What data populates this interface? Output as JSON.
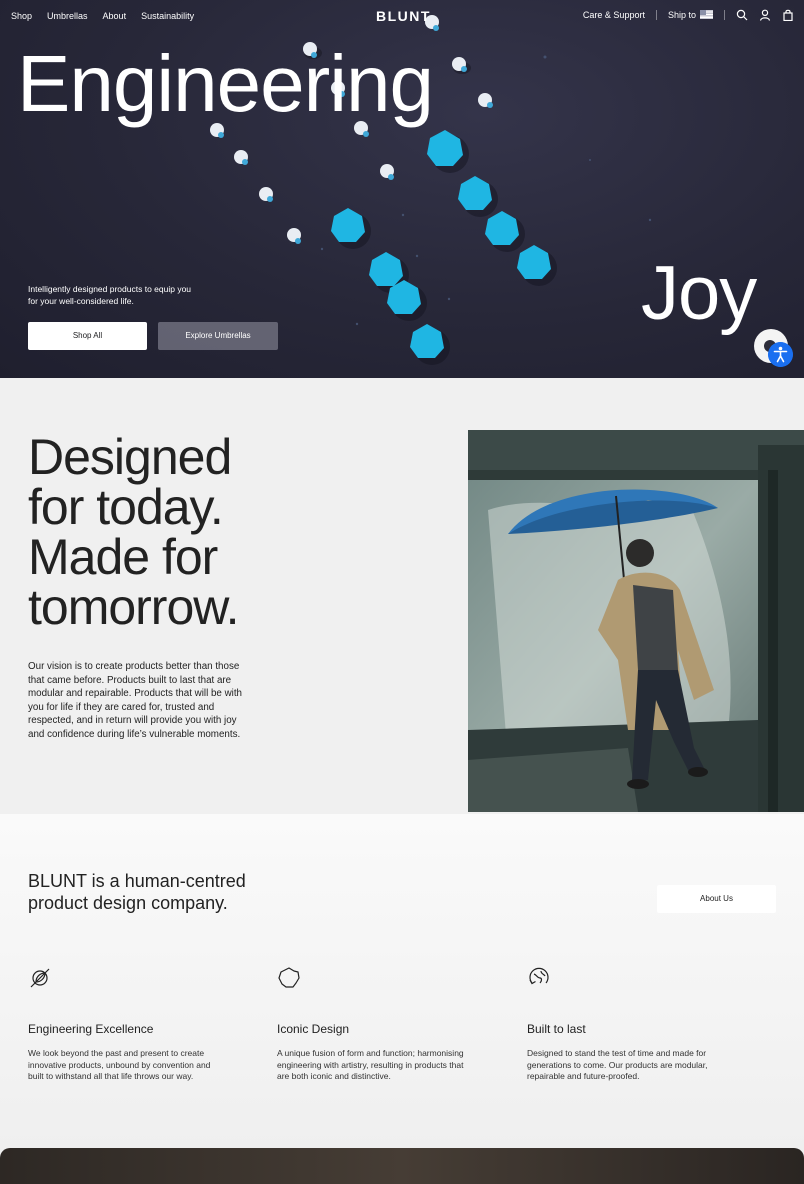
{
  "nav": {
    "links": [
      "Shop",
      "Umbrellas",
      "About",
      "Sustainability"
    ],
    "logo": "BLUNT",
    "care": "Care & Support",
    "ship": "Ship to"
  },
  "hero": {
    "title": "Engineering",
    "word": "Joy",
    "subtitle": "Intelligently designed products to equip you for your well-considered life.",
    "shop_button": "Shop All",
    "explore_button": "Explore Umbrellas"
  },
  "designed": {
    "heading_lines": [
      "Designed",
      "for today.",
      "Made for",
      "tomorrow."
    ],
    "body": "Our vision is to create products better than those that came before. Products built to last that are modular and repairable. Products that will be with you for life if they are cared for, trusted and respected, and in return will provide you with joy and confidence during life’s vulnerable moments."
  },
  "brand": {
    "heading": "BLUNT is a human-centred product design company.",
    "about_button": "About Us",
    "features": [
      {
        "icon": "leaf-circle-icon",
        "title": "Engineering Excellence",
        "body": "We look beyond the past and present to create innovative products, unbound by convention and built to withstand all that life throws our way."
      },
      {
        "icon": "blunt-shape-icon",
        "title": "Iconic Design",
        "body": "A unique fusion of form and function; harmonising engineering with artistry, resulting in products that are both iconic and distinctive."
      },
      {
        "icon": "globe-recycle-icon",
        "title": "Built to last",
        "body": "Designed to stand the test of time and made for generations to come. Our products are modular, repairable and future-proofed."
      }
    ]
  },
  "colors": {
    "accent_umbrella": "#1fb6e3",
    "hero_bg": "#272738",
    "accessibility": "#1a6ff0"
  }
}
